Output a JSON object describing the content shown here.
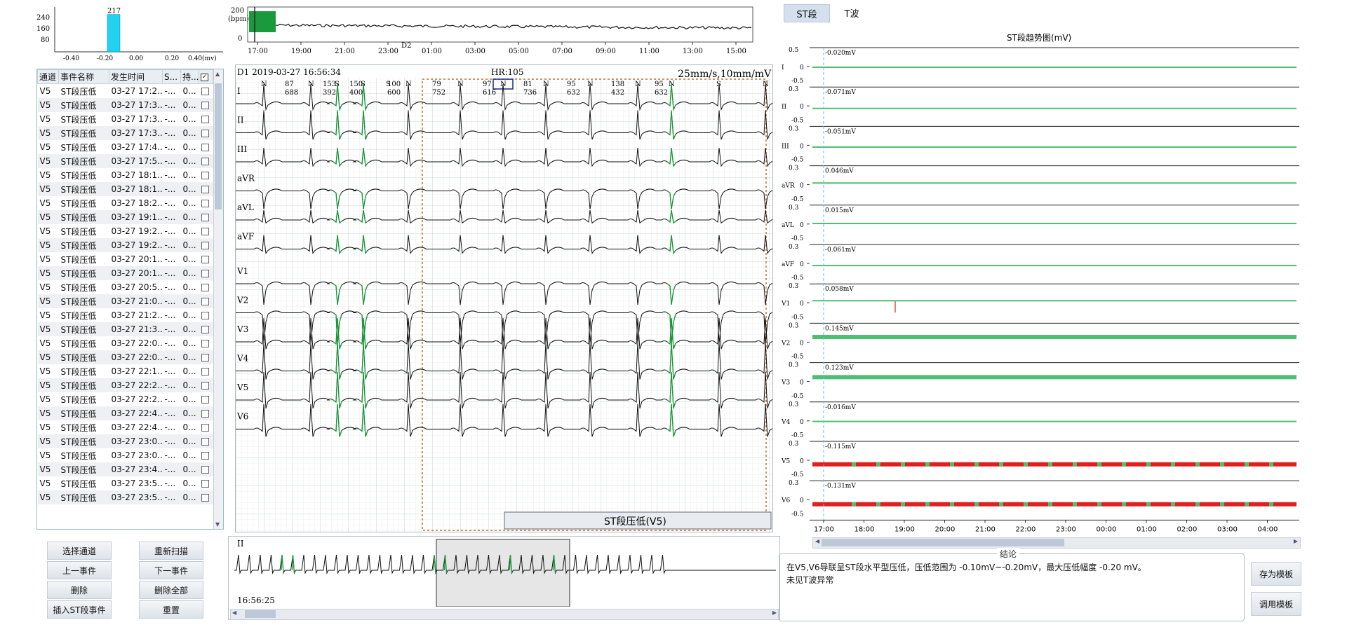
{
  "histogram": {
    "y_ticks": [
      "240",
      "160",
      "80"
    ],
    "x_ticks": [
      "-0.40",
      "-0.20",
      "0.00",
      "0.20",
      "0.40(mv)"
    ],
    "bar_label": "217",
    "bar_value": 217,
    "bar_x": -0.2
  },
  "event_table": {
    "headers": [
      "通道",
      "事件名称",
      "发生时间",
      "S...",
      "持..."
    ],
    "rows": [
      [
        "V5",
        "ST段压低",
        "03-27 17:2...",
        "-...",
        "0..."
      ],
      [
        "V5",
        "ST段压低",
        "03-27 17:3...",
        "-...",
        "0..."
      ],
      [
        "V5",
        "ST段压低",
        "03-27 17:3...",
        "-...",
        "0..."
      ],
      [
        "V5",
        "ST段压低",
        "03-27 17:3...",
        "-...",
        "0..."
      ],
      [
        "V5",
        "ST段压低",
        "03-27 17:4...",
        "-...",
        "0..."
      ],
      [
        "V5",
        "ST段压低",
        "03-27 17:5...",
        "-...",
        "0..."
      ],
      [
        "V5",
        "ST段压低",
        "03-27 18:1...",
        "-...",
        "0..."
      ],
      [
        "V5",
        "ST段压低",
        "03-27 18:1...",
        "-...",
        "0..."
      ],
      [
        "V5",
        "ST段压低",
        "03-27 18:2...",
        "-...",
        "0..."
      ],
      [
        "V5",
        "ST段压低",
        "03-27 19:1...",
        "-...",
        "0..."
      ],
      [
        "V5",
        "ST段压低",
        "03-27 19:2...",
        "-...",
        "0..."
      ],
      [
        "V5",
        "ST段压低",
        "03-27 19:2...",
        "-...",
        "0..."
      ],
      [
        "V5",
        "ST段压低",
        "03-27 20:1...",
        "-...",
        "0..."
      ],
      [
        "V5",
        "ST段压低",
        "03-27 20:1...",
        "-...",
        "0..."
      ],
      [
        "V5",
        "ST段压低",
        "03-27 20:5...",
        "-...",
        "0..."
      ],
      [
        "V5",
        "ST段压低",
        "03-27 21:0...",
        "-...",
        "0..."
      ],
      [
        "V5",
        "ST段压低",
        "03-27 21:2...",
        "-...",
        "0..."
      ],
      [
        "V5",
        "ST段压低",
        "03-27 21:3...",
        "-...",
        "0..."
      ],
      [
        "V5",
        "ST段压低",
        "03-27 22:0...",
        "-...",
        "0..."
      ],
      [
        "V5",
        "ST段压低",
        "03-27 22:0...",
        "-...",
        "0..."
      ],
      [
        "V5",
        "ST段压低",
        "03-27 22:1...",
        "-...",
        "0..."
      ],
      [
        "V5",
        "ST段压低",
        "03-27 22:2...",
        "-...",
        "0..."
      ],
      [
        "V5",
        "ST段压低",
        "03-27 22:2...",
        "-...",
        "0..."
      ],
      [
        "V5",
        "ST段压低",
        "03-27 22:4...",
        "-...",
        "0..."
      ],
      [
        "V5",
        "ST段压低",
        "03-27 22:4...",
        "-...",
        "0..."
      ],
      [
        "V5",
        "ST段压低",
        "03-27 23:0...",
        "-...",
        "0..."
      ],
      [
        "V5",
        "ST段压低",
        "03-27 23:0...",
        "-...",
        "0..."
      ],
      [
        "V5",
        "ST段压低",
        "03-27 23:4...",
        "-...",
        "0..."
      ],
      [
        "V5",
        "ST段压低",
        "03-27 23:5...",
        "-...",
        "0..."
      ],
      [
        "V5",
        "ST段压低",
        "03-27 23:5...",
        "-...",
        "0..."
      ]
    ]
  },
  "buttons": {
    "select_channel": "选择通道",
    "rescan": "重新扫描",
    "prev_event": "上一事件",
    "next_event": "下一事件",
    "delete": "删除",
    "delete_all": "删除全部",
    "insert_st": "插入ST段事件",
    "reset": "重置",
    "save_template": "存为模板",
    "load_template": "调用模板"
  },
  "hr_trend": {
    "y_max": "200",
    "y_unit": "(bpm)",
    "y_min": "0",
    "x_ticks": [
      "17:00",
      "19:00",
      "21:00",
      "23:00",
      "01:00",
      "03:00",
      "05:00",
      "07:00",
      "09:00",
      "11:00",
      "13:00",
      "15:00"
    ],
    "day_marker": "D2"
  },
  "ecg": {
    "header_date": "D1 2019-03-27 16:56:34",
    "hr": "HR:105",
    "speed": "25mm/s,10mm/mV",
    "leads": [
      "I",
      "II",
      "III",
      "aVR",
      "aVL",
      "aVF",
      "V1",
      "V2",
      "V3",
      "V4",
      "V5",
      "V6"
    ],
    "beat_labels": [
      "N",
      "N",
      "S",
      "S",
      "S",
      "N",
      "N",
      "N",
      "N",
      "N",
      "N",
      "N",
      "S",
      "N"
    ],
    "rr_top": [
      "87",
      "153",
      "150",
      "100",
      "79",
      "97",
      "81",
      "95",
      "138",
      "95"
    ],
    "rr_bottom": [
      "688",
      "392",
      "400",
      "600",
      "752",
      "616",
      "736",
      "632",
      "432",
      "632"
    ],
    "event_label": "ST段压低(V5)"
  },
  "strip": {
    "lead": "II",
    "time": "16:56:25"
  },
  "tabs": [
    "ST段",
    "T波"
  ],
  "st_trend": {
    "title": "ST段趋势图(mV)",
    "leads": [
      "I",
      "II",
      "III",
      "aVR",
      "aVL",
      "aVF",
      "V1",
      "V2",
      "V3",
      "V4",
      "V5",
      "V6"
    ],
    "values": [
      "-0.020mV",
      "-0.071mV",
      "-0.051mV",
      "0.046mV",
      "0.015mV",
      "-0.061mV",
      "0.058mV",
      "0.145mV",
      "0.123mV",
      "-0.016mV",
      "-0.115mV",
      "-0.131mV"
    ],
    "scale_top": "0.5",
    "scale_mid": "0",
    "scale_bot": "-0.5",
    "scale_top_short": "0.3",
    "x_ticks": [
      "17:00",
      "18:00",
      "19:00",
      "20:00",
      "21:00",
      "22:00",
      "23:00",
      "00:00",
      "01:00",
      "02:00",
      "03:00",
      "04:00"
    ],
    "colors": {
      "normal": "#4cc070",
      "abnormal": "#e02020"
    }
  },
  "conclusion": {
    "legend": "结论",
    "line1": "在V5,V6导联呈ST段水平型压低，压低范围为 -0.10mV~-0.20mV，最大压低幅度 -0.20 mV。",
    "line2": "未见T波异常"
  }
}
